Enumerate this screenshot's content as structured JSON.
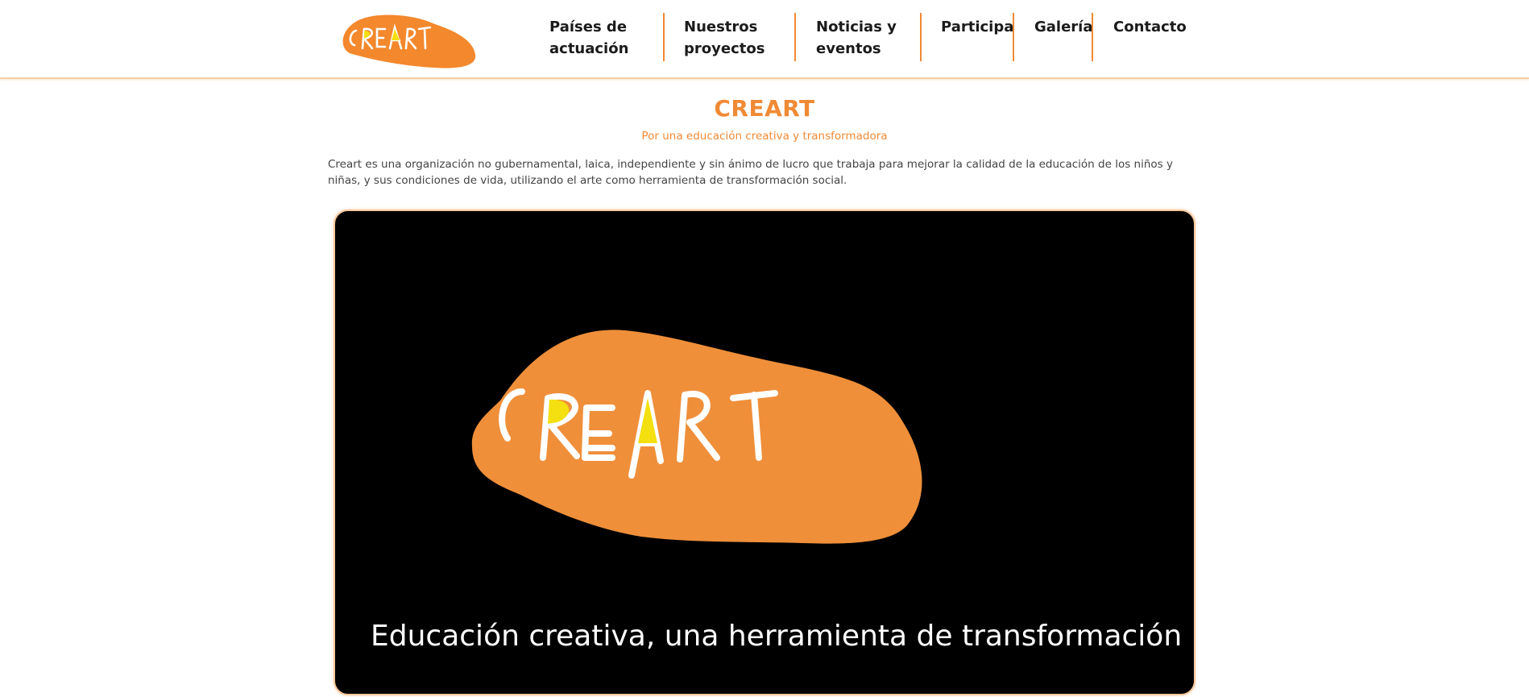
{
  "header": {
    "logo_text": "CREART",
    "nav": [
      {
        "label": "Países de actuación"
      },
      {
        "label": "Nuestros proyectos"
      },
      {
        "label": "Noticias y eventos"
      },
      {
        "label": "Participa"
      },
      {
        "label": "Galería"
      },
      {
        "label": "Contacto"
      }
    ]
  },
  "main": {
    "title": "CREART",
    "subtitle": "Por una educación creativa y transformadora",
    "intro": "Creart es una organización no gubernamental, laica, independiente y sin ánimo de lucro que trabaja para mejorar la calidad de la educación de los niños y niñas, y sus condiciones de vida, utilizando el arte como herramienta de transformación social.",
    "video": {
      "logo_text": "CREART",
      "caption": "Educación creativa, una herramienta de transformación"
    }
  },
  "colors": {
    "accent": "#f08a35",
    "logo_orange": "#ef8f3a",
    "logo_yellow": "#f4df10",
    "video_bg": "#000000"
  }
}
